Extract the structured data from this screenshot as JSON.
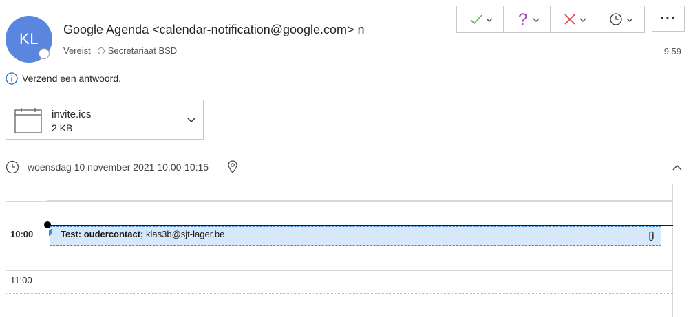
{
  "sender": {
    "initials": "KL",
    "name": "Google Agenda <calendar-notification@google.com> n",
    "required_label": "Vereist",
    "recipient": "Secretariaat BSD",
    "time": "9:59"
  },
  "rsvp": {
    "accept_icon": "check-icon",
    "tentative_icon": "question-icon",
    "decline_icon": "x-icon",
    "propose_icon": "clock-icon",
    "more_label": "···"
  },
  "info": {
    "text": "Verzend een antwoord."
  },
  "attachment": {
    "filename": "invite.ics",
    "size": "2 KB"
  },
  "meeting": {
    "when": "woensdag 10 november 2021 10:00-10:15"
  },
  "calendar": {
    "hours": [
      "10:00",
      "11:00"
    ],
    "event": {
      "title": "Test: oudercontact;",
      "organizer": "klas3b@sjt-lager.be"
    }
  },
  "colors": {
    "avatar": "#5b86e0",
    "accept": "#5fb35a",
    "tentative": "#a447b8",
    "decline": "#d9434a",
    "event_bg": "#d6e8fa",
    "event_border": "#3a8ad6"
  }
}
